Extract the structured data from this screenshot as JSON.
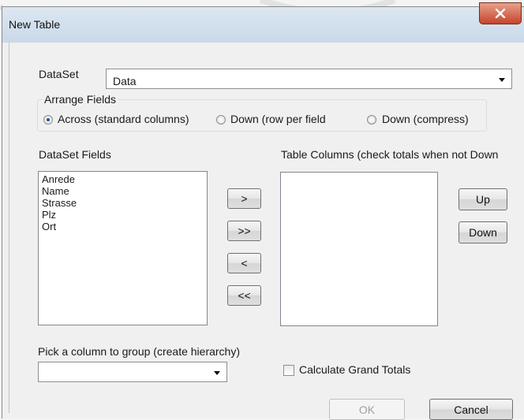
{
  "window": {
    "title": "New Table",
    "close_glyph": "x"
  },
  "dataset": {
    "label": "DataSet",
    "selected": "Data"
  },
  "arrange": {
    "title": "Arrange Fields",
    "options": [
      {
        "label": "Across (standard columns)",
        "checked": true
      },
      {
        "label": "Down (row per field",
        "checked": false
      },
      {
        "label": "Down (compress)",
        "checked": false
      }
    ]
  },
  "dataset_fields": {
    "label": "DataSet Fields",
    "items": [
      "Anrede",
      "Name",
      "Strasse",
      "Plz",
      "Ort"
    ]
  },
  "table_columns": {
    "label": "Table Columns (check totals when not Down"
  },
  "move_buttons": {
    "add": ">",
    "add_all": ">>",
    "remove": "<",
    "remove_all": "<<"
  },
  "order_buttons": {
    "up": "Up",
    "down": "Down"
  },
  "group": {
    "label": "Pick a column to group (create hierarchy)",
    "selected": ""
  },
  "grand_totals": {
    "label": "Calculate Grand Totals",
    "checked": false
  },
  "footer": {
    "ok": "OK",
    "cancel": "Cancel"
  }
}
